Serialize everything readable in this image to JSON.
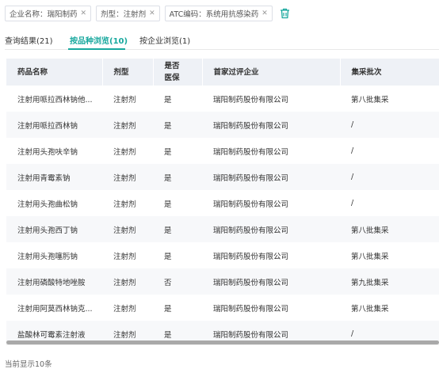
{
  "filters": [
    {
      "label": "企业名称：瑞阳制药"
    },
    {
      "label": "剂型：注射剂"
    },
    {
      "label": "ATC编码：系统用抗感染药"
    }
  ],
  "tabs": [
    {
      "label": "查询结果(21)"
    },
    {
      "label": "按品种浏览(10)",
      "active": true
    },
    {
      "label": "按企业浏览(1)"
    }
  ],
  "table": {
    "columns": [
      "药品名称",
      "剂型",
      "是否医保",
      "首家过评企业",
      "集采批次"
    ],
    "rows": [
      [
        "注射用哌拉西林钠他...",
        "注射剂",
        "是",
        "瑞阳制药股份有限公司",
        "第八批集采"
      ],
      [
        "注射用哌拉西林钠",
        "注射剂",
        "是",
        "瑞阳制药股份有限公司",
        "/"
      ],
      [
        "注射用头孢呋辛钠",
        "注射剂",
        "是",
        "瑞阳制药股份有限公司",
        "/"
      ],
      [
        "注射用青霉素钠",
        "注射剂",
        "是",
        "瑞阳制药股份有限公司",
        "/"
      ],
      [
        "注射用头孢曲松钠",
        "注射剂",
        "是",
        "瑞阳制药股份有限公司",
        "/"
      ],
      [
        "注射用头孢西丁钠",
        "注射剂",
        "是",
        "瑞阳制药股份有限公司",
        "第八批集采"
      ],
      [
        "注射用头孢噻肟钠",
        "注射剂",
        "是",
        "瑞阳制药股份有限公司",
        "第八批集采"
      ],
      [
        "注射用磷酸特地唑胺",
        "注射剂",
        "否",
        "瑞阳制药股份有限公司",
        "第九批集采"
      ],
      [
        "注射用阿莫西林钠克...",
        "注射剂",
        "是",
        "瑞阳制药股份有限公司",
        "第八批集采"
      ],
      [
        "盐酸林可霉素注射液",
        "注射剂",
        "是",
        "瑞阳制药股份有限公司",
        "/"
      ]
    ]
  },
  "footer": {
    "text": "当前显示10条"
  },
  "colors": {
    "accent": "#18a89e",
    "header_bg": "#eef1f6",
    "stripe": "#f7f8fa"
  }
}
